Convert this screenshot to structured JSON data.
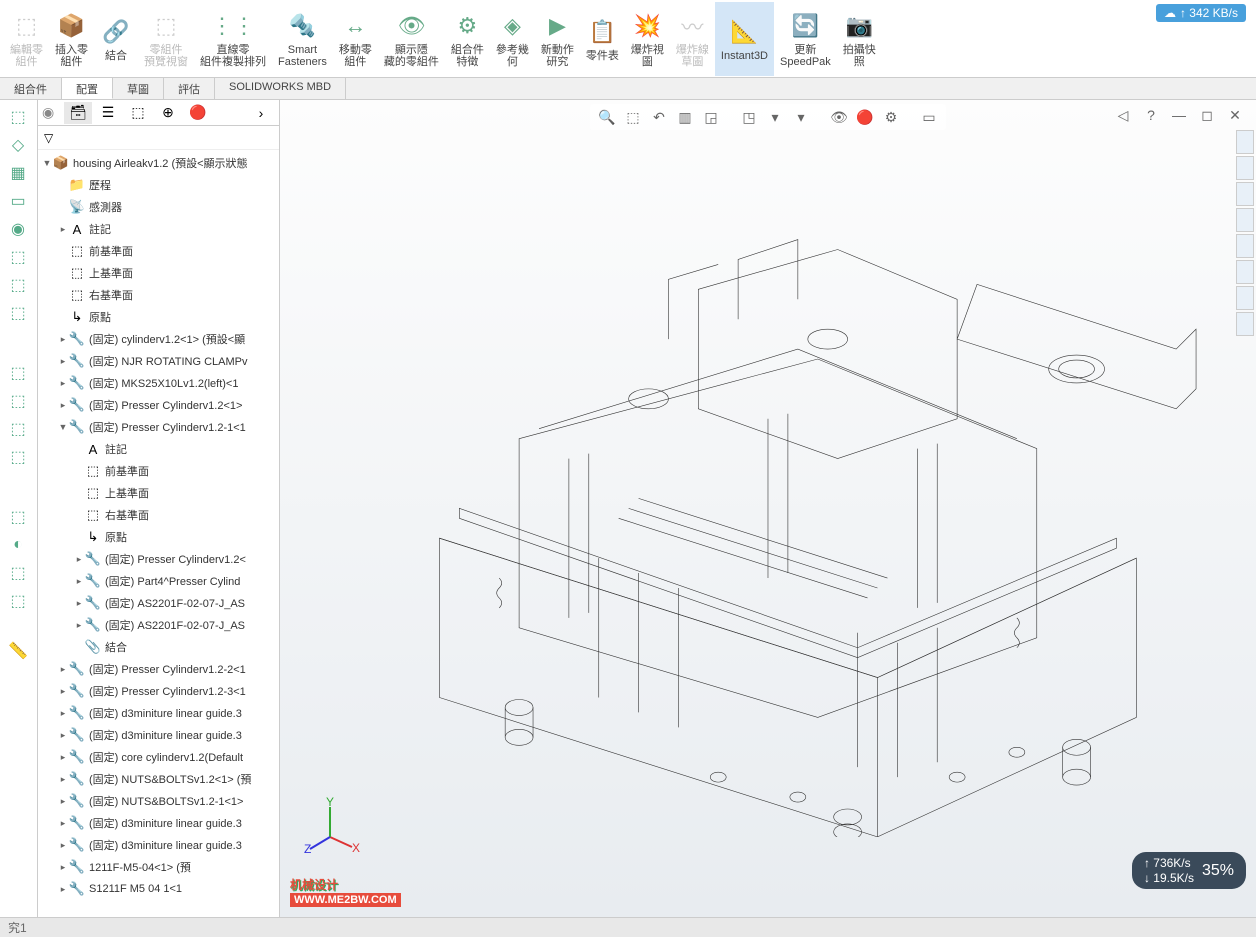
{
  "ribbon": [
    {
      "label": "編輯零\n組件",
      "icon": "⬚",
      "dis": true
    },
    {
      "label": "插入零\n組件",
      "icon": "📦"
    },
    {
      "label": "結合",
      "icon": "🔗"
    },
    {
      "label": "零組件\n預覽視窗",
      "icon": "⬚",
      "dis": true
    },
    {
      "label": "直線零\n組件複製排列",
      "icon": "⋮⋮"
    },
    {
      "label": "Smart\nFasteners",
      "icon": "🔩"
    },
    {
      "label": "移動零\n組件",
      "icon": "↔"
    },
    {
      "label": "顯示隱\n藏的零組件",
      "icon": "👁"
    },
    {
      "label": "組合件\n特徵",
      "icon": "⚙"
    },
    {
      "label": "參考幾\n何",
      "icon": "◈"
    },
    {
      "label": "新動作\n研究",
      "icon": "▶"
    },
    {
      "label": "零件表",
      "icon": "📋"
    },
    {
      "label": "爆炸視\n圖",
      "icon": "💥"
    },
    {
      "label": "爆炸線\n草圖",
      "icon": "〰",
      "dis": true
    },
    {
      "label": "Instant3D",
      "icon": "📐",
      "active": true
    },
    {
      "label": "更新\nSpeedPak",
      "icon": "🔄"
    },
    {
      "label": "拍攝快\n照",
      "icon": "📷"
    }
  ],
  "speed": "↑ 342 KB/s",
  "tabs": [
    "組合件",
    "配置",
    "草圖",
    "評估",
    "SOLIDWORKS MBD"
  ],
  "activeTab": 1,
  "assembly": "housing Airleakv1.2  (預設<顯示狀態",
  "tree": [
    {
      "d": 0,
      "e": "▼",
      "i": "📦",
      "t": "housing Airleakv1.2  (預設<顯示狀態"
    },
    {
      "d": 1,
      "e": "",
      "i": "📁",
      "t": "歷程"
    },
    {
      "d": 1,
      "e": "",
      "i": "📡",
      "t": "感測器"
    },
    {
      "d": 1,
      "e": "▸",
      "i": "A",
      "t": "註記"
    },
    {
      "d": 1,
      "e": "",
      "i": "⬚",
      "t": "前基準面"
    },
    {
      "d": 1,
      "e": "",
      "i": "⬚",
      "t": "上基準面"
    },
    {
      "d": 1,
      "e": "",
      "i": "⬚",
      "t": "右基準面"
    },
    {
      "d": 1,
      "e": "",
      "i": "↳",
      "t": "原點"
    },
    {
      "d": 1,
      "e": "▸",
      "i": "🔧",
      "t": "(固定) cylinderv1.2<1> (預設<顯"
    },
    {
      "d": 1,
      "e": "▸",
      "i": "🔧",
      "t": "(固定) NJR ROTATING CLAMPv"
    },
    {
      "d": 1,
      "e": "▸",
      "i": "🔧",
      "t": "(固定) MKS25X10Lv1.2(left)<1"
    },
    {
      "d": 1,
      "e": "▸",
      "i": "🔧",
      "t": "(固定) Presser Cylinderv1.2<1>"
    },
    {
      "d": 1,
      "e": "▼",
      "i": "🔧",
      "t": "(固定) Presser Cylinderv1.2-1<1"
    },
    {
      "d": 2,
      "e": "",
      "i": "A",
      "t": "註記"
    },
    {
      "d": 2,
      "e": "",
      "i": "⬚",
      "t": "前基準面"
    },
    {
      "d": 2,
      "e": "",
      "i": "⬚",
      "t": "上基準面"
    },
    {
      "d": 2,
      "e": "",
      "i": "⬚",
      "t": "右基準面"
    },
    {
      "d": 2,
      "e": "",
      "i": "↳",
      "t": "原點"
    },
    {
      "d": 2,
      "e": "▸",
      "i": "🔧",
      "t": "(固定) Presser Cylinderv1.2<"
    },
    {
      "d": 2,
      "e": "▸",
      "i": "🔧",
      "t": "(固定) Part4^Presser Cylind"
    },
    {
      "d": 2,
      "e": "▸",
      "i": "🔧",
      "t": "(固定) AS2201F-02-07-J_AS"
    },
    {
      "d": 2,
      "e": "▸",
      "i": "🔧",
      "t": "(固定) AS2201F-02-07-J_AS"
    },
    {
      "d": 2,
      "e": "",
      "i": "📎",
      "t": "結合"
    },
    {
      "d": 1,
      "e": "▸",
      "i": "🔧",
      "t": "(固定) Presser Cylinderv1.2-2<1"
    },
    {
      "d": 1,
      "e": "▸",
      "i": "🔧",
      "t": "(固定) Presser Cylinderv1.2-3<1"
    },
    {
      "d": 1,
      "e": "▸",
      "i": "🔧",
      "t": "(固定) d3miniture linear guide.3"
    },
    {
      "d": 1,
      "e": "▸",
      "i": "🔧",
      "t": "(固定) d3miniture linear guide.3"
    },
    {
      "d": 1,
      "e": "▸",
      "i": "🔧",
      "t": "(固定) core cylinderv1.2(Default"
    },
    {
      "d": 1,
      "e": "▸",
      "i": "🔧",
      "t": "(固定) NUTS&BOLTSv1.2<1> (預"
    },
    {
      "d": 1,
      "e": "▸",
      "i": "🔧",
      "t": "(固定) NUTS&BOLTSv1.2-1<1>"
    },
    {
      "d": 1,
      "e": "▸",
      "i": "🔧",
      "t": "(固定) d3miniture linear guide.3"
    },
    {
      "d": 1,
      "e": "▸",
      "i": "🔧",
      "t": "(固定) d3miniture linear guide.3"
    },
    {
      "d": 1,
      "e": "▸",
      "i": "🔧",
      "t": "1211F-M5-04<1> (預"
    },
    {
      "d": 1,
      "e": "▸",
      "i": "🔧",
      "t": "S1211F M5 04 1<1"
    }
  ],
  "status": "究1",
  "watermark_l1": "机械设计",
  "watermark_l2": "WWW.ME2BW.COM",
  "perf": {
    "up": "↑ 736K/s",
    "down": "↓ 19.5K/s",
    "pct": "35%"
  }
}
